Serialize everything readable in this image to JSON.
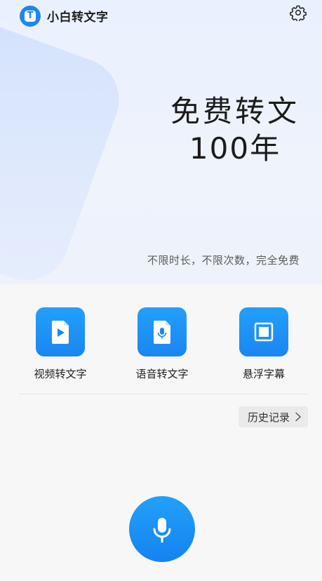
{
  "app": {
    "title": "小白转文字",
    "logo_letter": "T"
  },
  "hero": {
    "headline_line1": "免费转文",
    "headline_line2": "100年",
    "subtitle": "不限时长，不限次数，完全免费"
  },
  "features": [
    {
      "label": "视频转文字",
      "icon": "video-file-icon"
    },
    {
      "label": "语音转文字",
      "icon": "audio-file-icon"
    },
    {
      "label": "悬浮字幕",
      "icon": "floating-window-icon"
    }
  ],
  "history": {
    "label": "历史记录",
    "icon": "chevron-right-icon"
  },
  "record": {
    "icon": "microphone-icon"
  },
  "colors": {
    "accent": "#1F86F1",
    "hero_bg": "#EAF1FE",
    "page_bg": "#F7F7F8"
  }
}
